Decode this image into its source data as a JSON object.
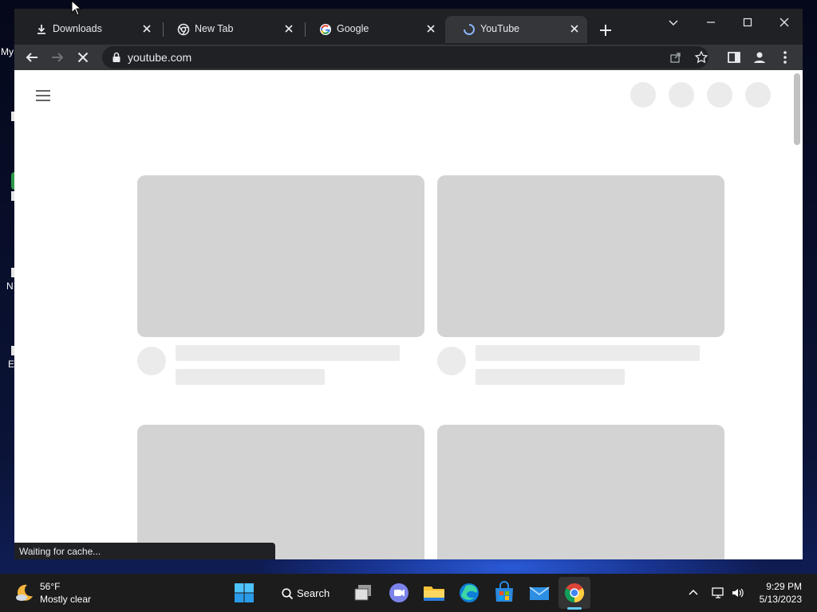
{
  "desktop": {
    "fragments": [
      "My",
      "N",
      "E"
    ]
  },
  "browser": {
    "tabs": [
      {
        "title": "Downloads",
        "icon": "download-icon",
        "active": false
      },
      {
        "title": "New Tab",
        "icon": "chrome-icon",
        "active": false
      },
      {
        "title": "Google",
        "icon": "google-icon",
        "active": false
      },
      {
        "title": "YouTube",
        "icon": "loading-spinner-icon",
        "active": true
      }
    ],
    "url": "youtube.com",
    "status_text": "Waiting for cache..."
  },
  "taskbar": {
    "weather": {
      "temp": "56°F",
      "desc": "Mostly clear"
    },
    "search_label": "Search",
    "clock": {
      "time": "9:29 PM",
      "date": "5/13/2023"
    }
  },
  "colors": {
    "tab_strip": "#202124",
    "toolbar": "#35363a",
    "skeleton_thumb": "#d3d3d3",
    "skeleton_light": "#ebebeb",
    "taskbar": "#1c1c1c",
    "accent": "#60cdff"
  }
}
